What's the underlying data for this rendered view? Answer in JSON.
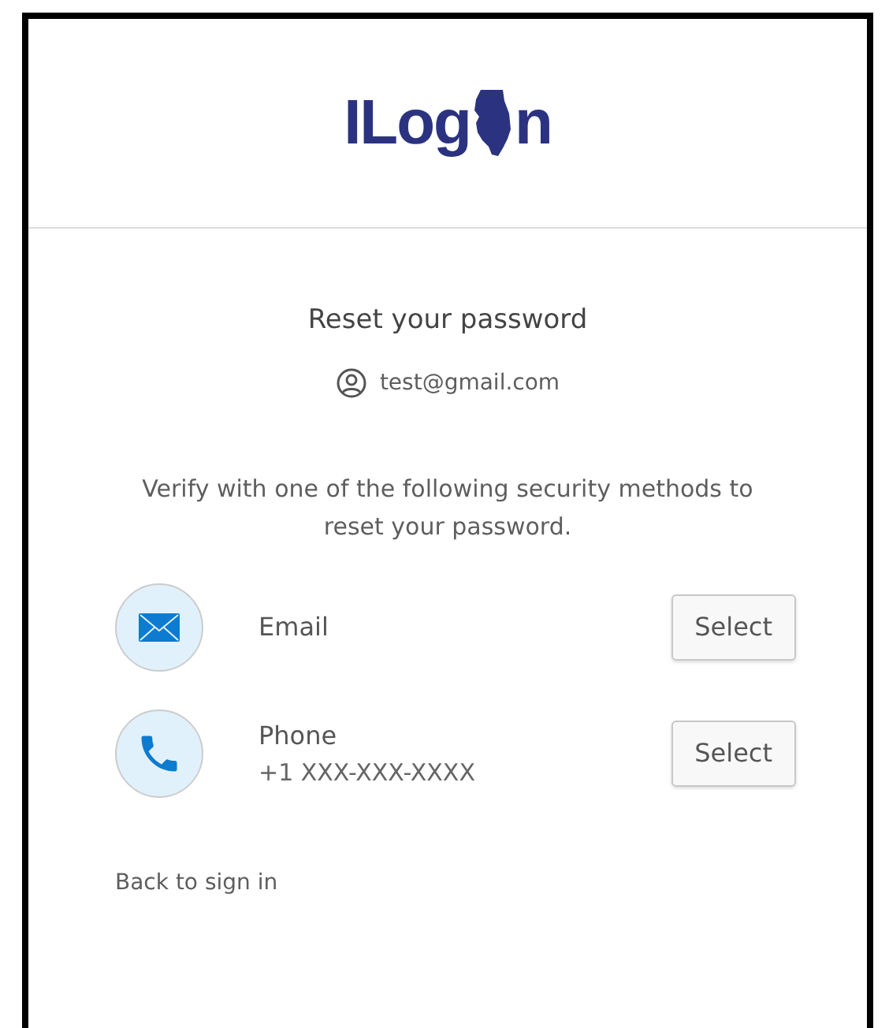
{
  "logo": {
    "text_before_mark": "ILog",
    "text_after_mark": "n"
  },
  "title": "Reset your password",
  "account": "test@gmail.com",
  "instructions": "Verify with one of the following security methods to reset your password.",
  "methods": [
    {
      "kind": "email",
      "label": "Email",
      "button": "Select"
    },
    {
      "kind": "phone",
      "label": "Phone",
      "detail": "+1 XXX-XXX-XXXX",
      "button": "Select"
    }
  ],
  "back_link": "Back to sign in"
}
